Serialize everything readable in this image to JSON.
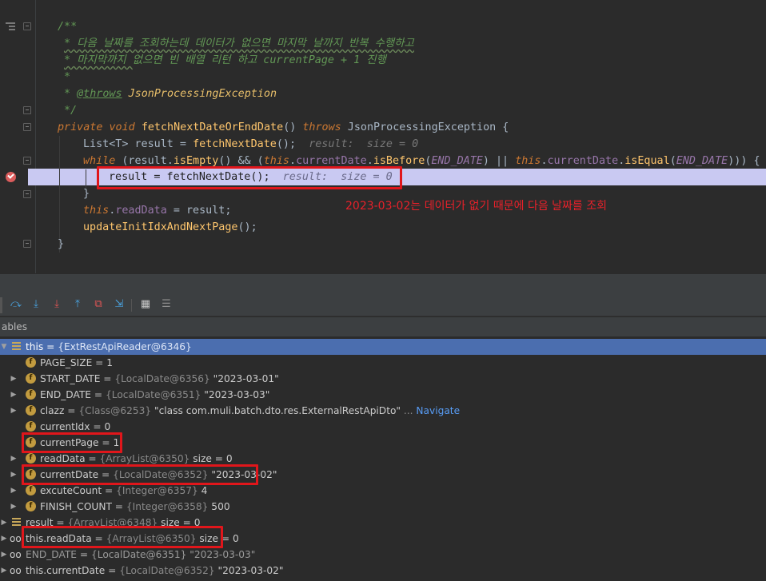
{
  "editor": {
    "doc_open": "/**",
    "doc_line1": "* 다음 날짜를 조회하는데 데이터가 없으면 마지막 날까지 반복 수행하고",
    "doc_line2_a": "* 마지막까지 ",
    "doc_line2_b": "없으면 빈 배열 리턴 하고 currentPage + 1 진행",
    "doc_star": "*",
    "doc_throws_star": "* ",
    "doc_throws_tag": "@throws",
    "doc_throws_type": " JsonProcessingException",
    "doc_close": "*/",
    "sig": {
      "private": "private",
      "void": "void",
      "name": "fetchNextDateOrEndDate",
      "parens": "() ",
      "throws": "throws",
      "exception": " JsonProcessingException {"
    },
    "line_list": {
      "type": "List<T> result = ",
      "call": "fetchNextDate",
      "tail": "();",
      "hint": "result:  size = 0"
    },
    "line_while": {
      "kw": "while",
      "a": " (result.",
      "isEmpty": "isEmpty",
      "b": "() && (",
      "this1": "this",
      "dot1": ".",
      "cur1": "currentDate",
      "dot2": ".",
      "isBefore": "isBefore",
      "c": "(",
      "end1": "END_DATE",
      "d": ") || ",
      "this2": "this",
      "dot3": ".",
      "cur2": "currentDate",
      "dot4": ".",
      "isEqual": "isEqual",
      "e": "(",
      "end2": "END_DATE",
      "f": "))) {"
    },
    "line_current": {
      "code": "result = fetchNextDate();",
      "hint": "result:  size = 0"
    },
    "close_brace": "}",
    "line_readdata": {
      "this": "this",
      "dot": ".",
      "field": "readData",
      "tail": " = result;"
    },
    "line_update": {
      "call": "updateInitIdxAndNextPage",
      "tail": "();"
    },
    "final_brace": "}"
  },
  "annotation": "2023-03-02는 데이터가 없기 때문에 다음 날짜를 조회",
  "debugger": {
    "panel_title": "ables",
    "toolbar_icons": [
      "step-over-icon",
      "step-into-icon",
      "force-step-into-icon",
      "step-out-icon",
      "drop-frame-icon",
      "run-to-cursor-icon",
      "evaluate-icon",
      "trace-icon"
    ],
    "variables": [
      {
        "name": "this",
        "ref": "{ExtRestApiReader@6346}",
        "value": ""
      },
      {
        "name": "PAGE_SIZE",
        "eq": " = ",
        "value": "1"
      },
      {
        "name": "START_DATE",
        "eq": " = ",
        "ref": "{LocalDate@6356}",
        "value": " \"2023-03-01\""
      },
      {
        "name": "END_DATE",
        "eq": " = ",
        "ref": "{LocalDate@6351}",
        "value": " \"2023-03-03\""
      },
      {
        "name": "clazz",
        "eq": " = ",
        "ref": "{Class@6253}",
        "value": " \"class com.muli.batch.dto.res.ExternalRestApiDto\"",
        "extra": " ... ",
        "nav": "Navigate"
      },
      {
        "name": "currentIdx",
        "eq": " = ",
        "value": "0"
      },
      {
        "name": "currentPage",
        "eq": " = ",
        "value": "1"
      },
      {
        "name": "readData",
        "eq": " = ",
        "ref": "{ArrayList@6350}",
        "value": "  size = 0"
      },
      {
        "name": "currentDate",
        "eq": " = ",
        "ref": "{LocalDate@6352}",
        "value": " \"2023-03-02\""
      },
      {
        "name": "excuteCount",
        "eq": " = ",
        "ref": "{Integer@6357}",
        "value": " 4"
      },
      {
        "name": "FINISH_COUNT",
        "eq": " = ",
        "ref": "{Integer@6358}",
        "value": " 500"
      },
      {
        "name": "result",
        "eq": " = ",
        "ref": "{ArrayList@6348}",
        "value": "  size = 0"
      },
      {
        "name": "this.readData",
        "eq": " = ",
        "ref": "{ArrayList@6350}",
        "value": "  size = 0"
      },
      {
        "name": "END_DATE",
        "eq": " = ",
        "ref": "{LocalDate@6351}",
        "value": " \"2023-03-03\""
      },
      {
        "name": "this.currentDate",
        "eq": " = ",
        "ref": "{LocalDate@6352}",
        "value": " \"2023-03-02\""
      }
    ]
  },
  "colors": {
    "editor_bg": "#2b2b2b",
    "exec_line": "#c9c9f2",
    "selected_row": "#4b6eaf",
    "annotation_red": "#e0161b"
  }
}
